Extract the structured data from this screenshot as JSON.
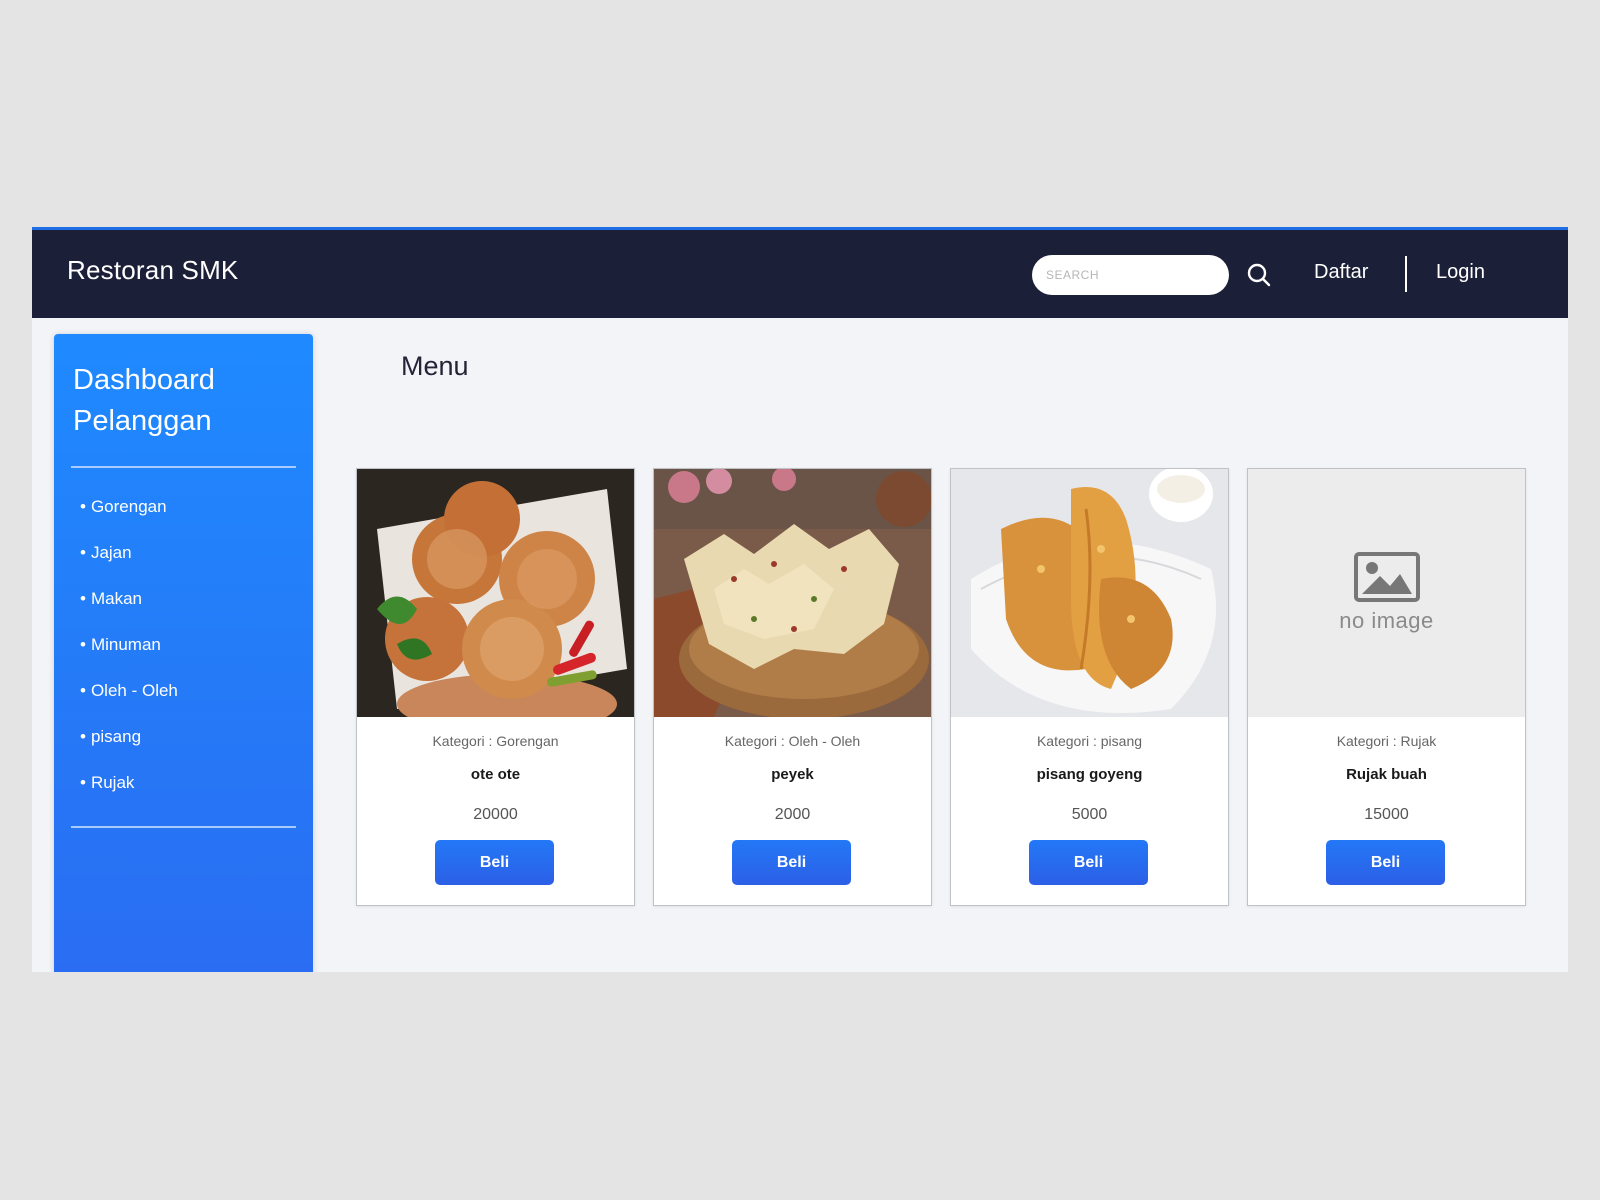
{
  "navbar": {
    "brand": "Restoran SMK",
    "search_placeholder": "SEARCH",
    "links": [
      {
        "label": "Daftar"
      },
      {
        "label": "Login"
      }
    ]
  },
  "sidebar": {
    "title_line1": "Dashboard",
    "title_line2": "Pelanggan",
    "items": [
      {
        "label": "Gorengan"
      },
      {
        "label": "Jajan"
      },
      {
        "label": "Makan"
      },
      {
        "label": "Minuman"
      },
      {
        "label": "Oleh - Oleh"
      },
      {
        "label": "pisang"
      },
      {
        "label": "Rujak"
      }
    ]
  },
  "main": {
    "title": "Menu",
    "products": [
      {
        "category": "Kategori : Gorengan",
        "name": "ote ote",
        "price": "20000",
        "button": "Beli"
      },
      {
        "category": "Kategori : Oleh - Oleh",
        "name": "peyek",
        "price": "2000",
        "button": "Beli"
      },
      {
        "category": "Kategori : pisang",
        "name": "pisang goyeng",
        "price": "5000",
        "button": "Beli"
      },
      {
        "category": "Kategori : Rujak",
        "name": "Rujak buah",
        "price": "15000",
        "button": "Beli",
        "image_text": "no image"
      }
    ]
  },
  "colors": {
    "navbar": "#1c1f38",
    "accent_top": "#1e6fe6",
    "sidebar_top": "#1f8aff",
    "sidebar_bottom": "#2a6cf2",
    "button": "#2a6cf2"
  },
  "icons": {
    "search": "search-icon",
    "bullet": "bullet-icon",
    "no_image": "image-placeholder-icon"
  }
}
